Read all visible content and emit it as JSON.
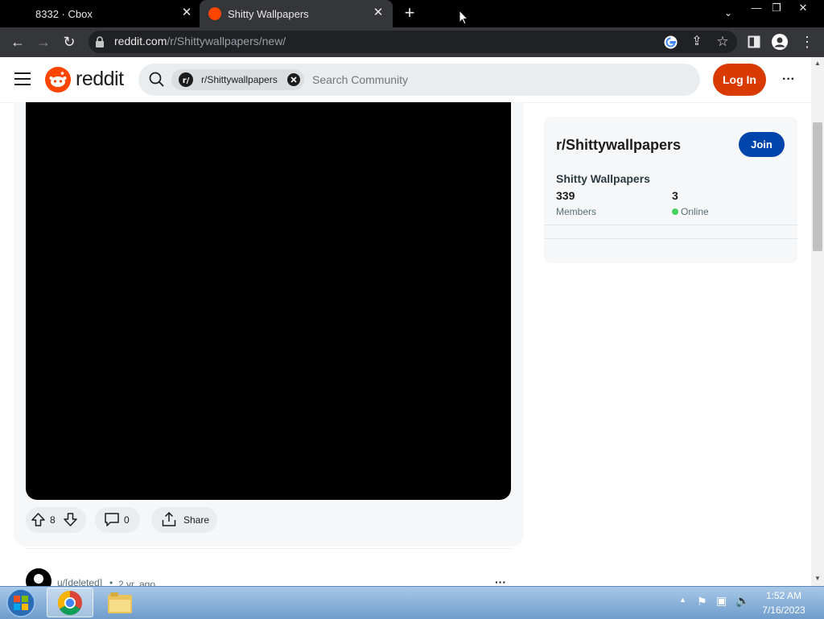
{
  "browser": {
    "tabs": [
      {
        "title": "8332 · Cbox",
        "active": false
      },
      {
        "title": "Shitty Wallpapers",
        "active": true
      }
    ],
    "new_tab_label": "+",
    "url_host": "reddit.com",
    "url_path": "/r/Shittywallpapers/new/"
  },
  "header": {
    "logo_text": "reddit",
    "community_chip": "r/Shittywallpapers",
    "search_placeholder": "Search Community",
    "login_label": "Log In",
    "more_label": "···"
  },
  "post": {
    "vote_count": "8",
    "comment_count": "0",
    "share_label": "Share"
  },
  "next_post": {
    "author": "u/[deleted]",
    "separator": "•",
    "age": "2 yr. ago",
    "more_label": "···"
  },
  "sidebar": {
    "community_name": "r/Shittywallpapers",
    "join_label": "Join",
    "display_name": "Shitty Wallpapers",
    "members_count": "339",
    "members_label": "Members",
    "online_count": "3",
    "online_label": "Online"
  },
  "taskbar": {
    "time": "1:52 AM",
    "date": "7/16/2023"
  },
  "colors": {
    "reddit_orange": "#ff4500",
    "login_button": "#d93a00",
    "join_button": "#0045ac",
    "online_dot": "#46d160"
  }
}
